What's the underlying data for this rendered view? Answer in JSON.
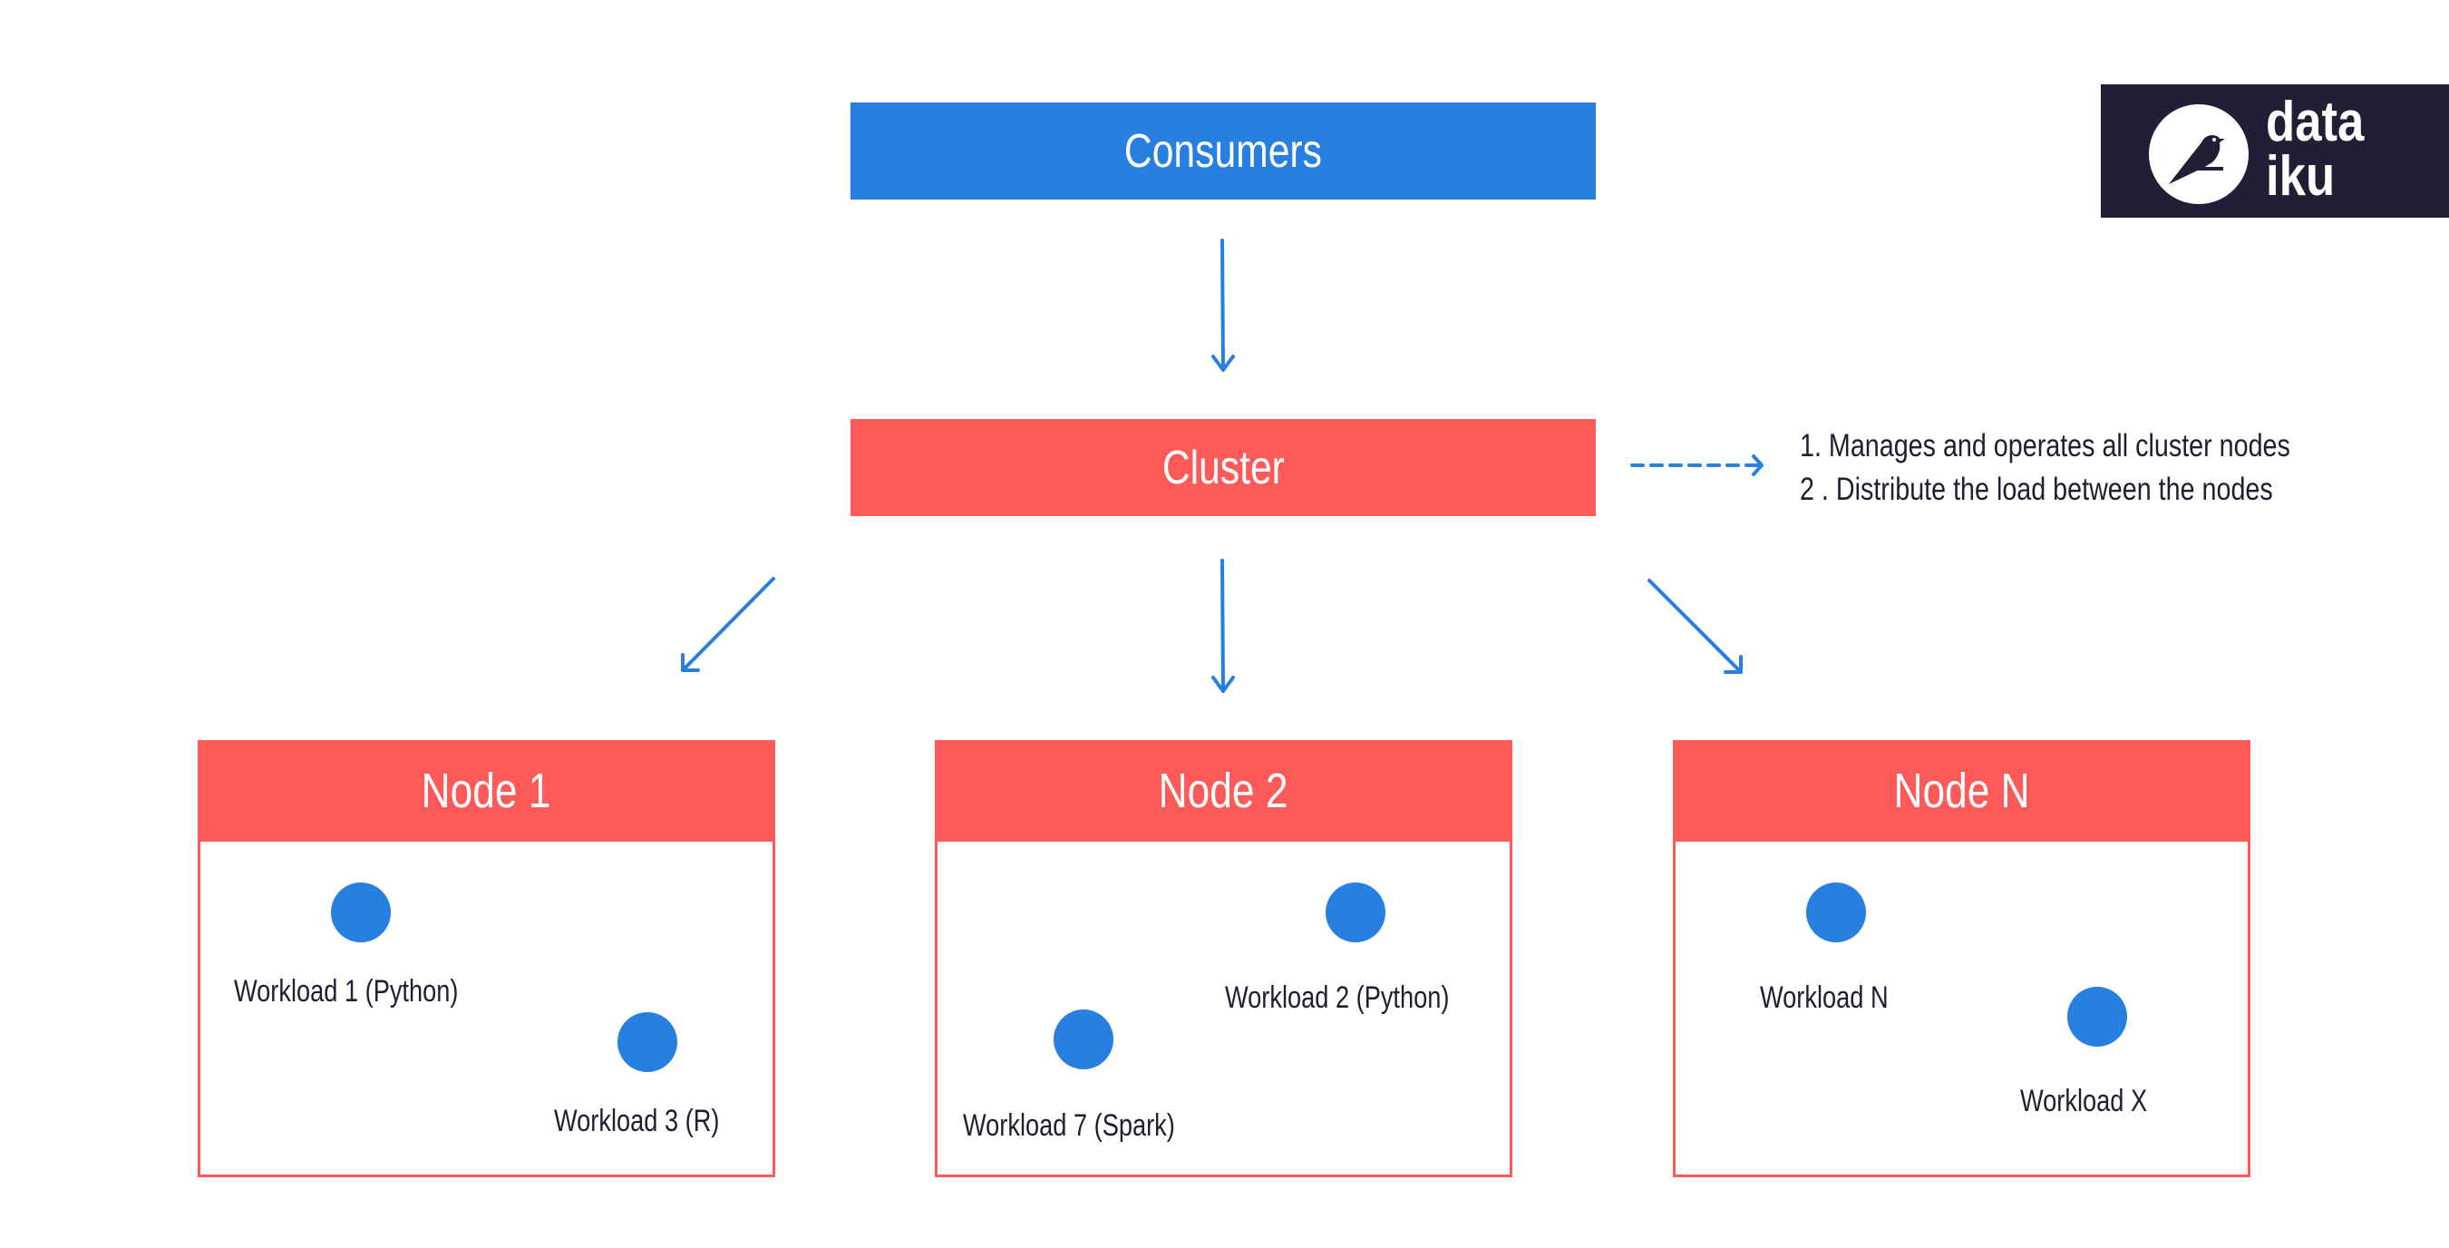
{
  "diagram": {
    "top": {
      "label": "Consumers",
      "color": "#277FE0"
    },
    "cluster": {
      "label": "Cluster",
      "color": "#FF5A5A",
      "notes": [
        "1. Manages and operates all cluster nodes",
        "2 . Distribute the load between the nodes"
      ]
    },
    "nodes": [
      {
        "label": "Node 1",
        "workloads": [
          "Workload 1 (Python)",
          "Workload 3 (R)"
        ]
      },
      {
        "label": "Node 2",
        "workloads": [
          "Workload 2 (Python)",
          "Workload 7 (Spark)"
        ]
      },
      {
        "label": "Node N",
        "workloads": [
          "Workload N",
          "Workload X"
        ]
      }
    ],
    "edges": [
      {
        "from": "Consumers",
        "to": "Cluster",
        "style": "solid"
      },
      {
        "from": "Cluster",
        "to": "Node 1",
        "style": "solid"
      },
      {
        "from": "Cluster",
        "to": "Node 2",
        "style": "solid"
      },
      {
        "from": "Cluster",
        "to": "Node N",
        "style": "solid"
      },
      {
        "from": "Cluster",
        "to": "notes",
        "style": "dashed"
      }
    ],
    "colors": {
      "accent_blue": "#277FE0",
      "accent_red": "#FF5A5A",
      "text": "#1F1D33",
      "logo_bg": "#221E35"
    }
  },
  "logo": {
    "line1": "data",
    "line2": "iku",
    "icon": "bird-icon"
  }
}
